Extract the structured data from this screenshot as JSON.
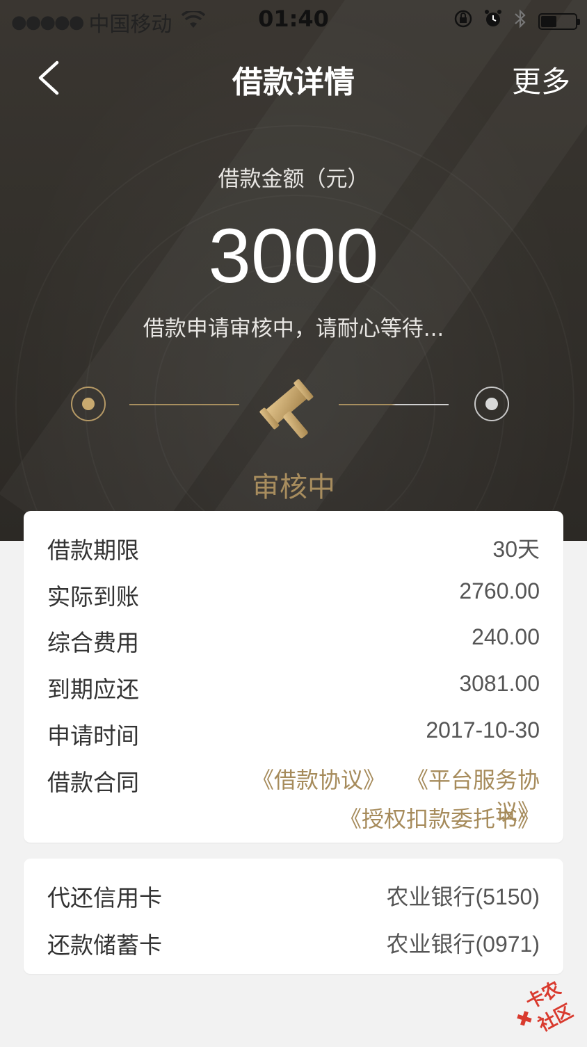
{
  "status_bar": {
    "signal": "●●●●●",
    "carrier": "中国移动",
    "time": "01:40",
    "wifi_icon": "wifi-icon",
    "battery_level": 0.45
  },
  "nav": {
    "back_icon": "chevron-left-icon",
    "title": "借款详情",
    "more": "更多"
  },
  "hero": {
    "amount_label": "借款金额（元）",
    "amount": "3000",
    "message": "借款申请审核中，请耐心等待...",
    "stage_label": "审核中",
    "stage_icon": "gavel-icon",
    "accent_color": "#a88d5e"
  },
  "details": {
    "rows": [
      {
        "label": "借款期限",
        "value": "30天"
      },
      {
        "label": "实际到账",
        "value": "2760.00"
      },
      {
        "label": "综合费用",
        "value": "240.00"
      },
      {
        "label": "到期应还",
        "value": "3081.00"
      },
      {
        "label": "申请时间",
        "value": "2017-10-30"
      }
    ],
    "contract_label": "借款合同",
    "contracts": [
      "《借款协议》",
      "《平台服务协议》",
      "《授权扣款委托书》"
    ]
  },
  "cards": {
    "rows": [
      {
        "label": "代还信用卡",
        "value": "农业银行(5150)"
      },
      {
        "label": "还款储蓄卡",
        "value": "农业银行(0971)"
      }
    ]
  },
  "watermark": {
    "text": "卡农社区",
    "icon": "kanong-logo-icon"
  }
}
